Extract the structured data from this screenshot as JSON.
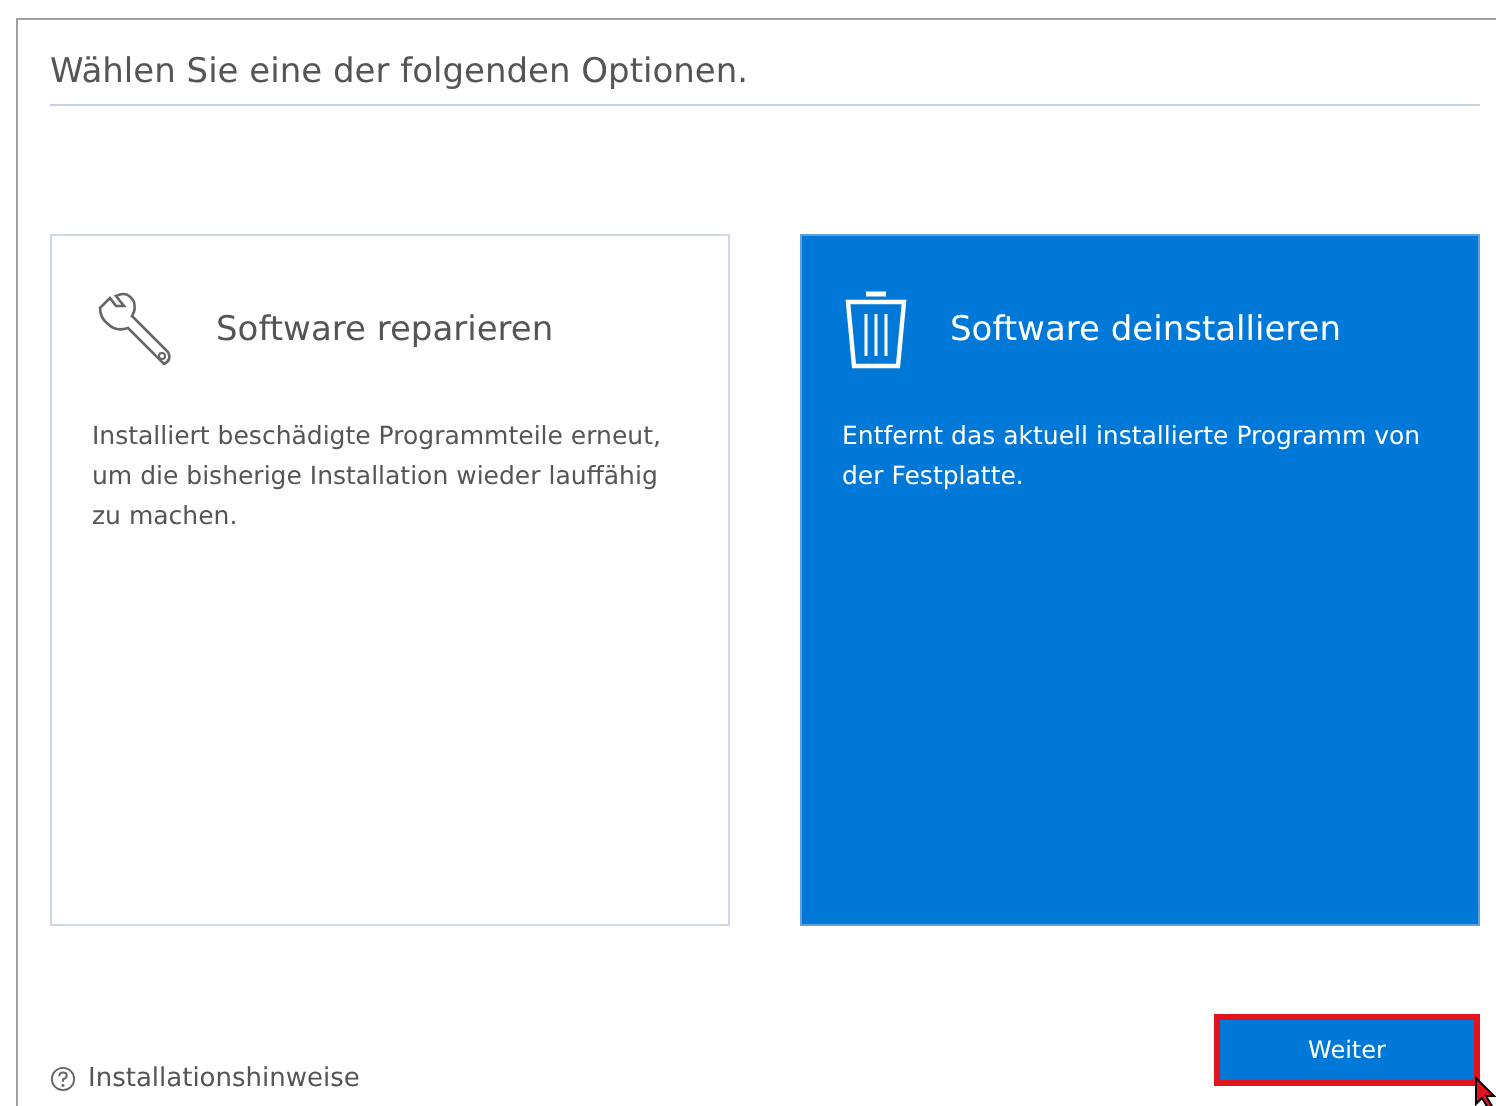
{
  "heading": "Wählen Sie eine der folgenden Optionen.",
  "options": [
    {
      "kind": "repair",
      "title": "Software reparieren",
      "description": "Installiert beschädigte Programmteile erneut, um die bisherige Installation wieder lauffähig zu machen.",
      "selected": false
    },
    {
      "kind": "uninstall",
      "title": "Software deinstallieren",
      "description": "Entfernt das aktuell installierte Programm von der Festplatte.",
      "selected": true
    }
  ],
  "help_link": "Installationshinweise",
  "next_button": "Weiter"
}
